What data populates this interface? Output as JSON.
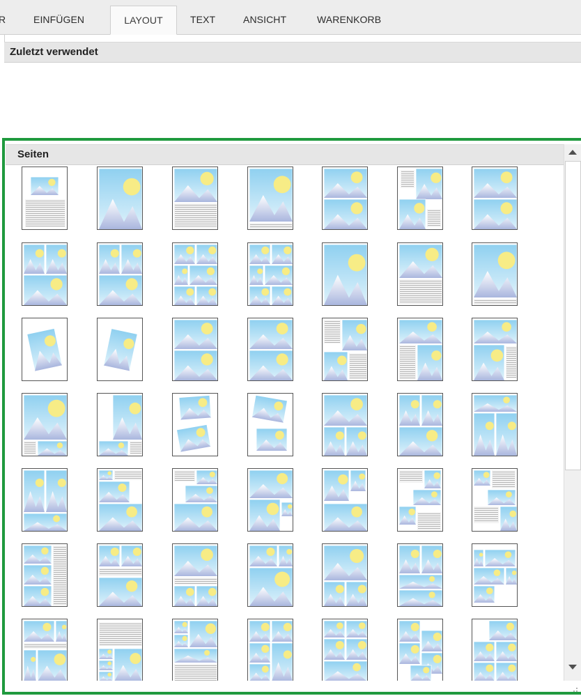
{
  "tabs": [
    {
      "label": "R",
      "active": false
    },
    {
      "label": "EINFÜGEN",
      "active": false
    },
    {
      "label": "LAYOUT",
      "active": true
    },
    {
      "label": "TEXT",
      "active": false
    },
    {
      "label": "ANSICHT",
      "active": false
    },
    {
      "label": "WARENKORB",
      "active": false
    }
  ],
  "recent": {
    "title": "Zuletzt verwendet"
  },
  "pages": {
    "title": "Seiten"
  },
  "colors": {
    "accent_border": "#1f9a3e",
    "photo_sky": "#bfe3f5",
    "photo_sun": "#f7ec86",
    "photo_mountain": "#e8eef8"
  },
  "icons": {
    "scroll_up": "triangle-up-icon",
    "scroll_down": "triangle-down-icon"
  },
  "layouts": [
    [
      "text-photo-small",
      "photo-full",
      "photo-text",
      "photo-textfoot",
      "photo-2h",
      "mixed-2",
      "photo-2h"
    ],
    [
      "photo-4",
      "photo-4",
      "photo-6",
      "photo-6",
      "photo-full",
      "photo-text",
      "photo-textfoot"
    ],
    [
      "tilted-1",
      "tilted-1b",
      "photo-2h",
      "photo-2h",
      "mixed-3",
      "mixed-3b",
      "mixed-3c"
    ],
    [
      "mixed-4",
      "mixed-4b",
      "tilted-2",
      "tilted-2b",
      "photo-3",
      "photo-3b",
      "photo-3c"
    ],
    [
      "photo-3d",
      "photo-4b",
      "mixed-5",
      "photo-4c",
      "mixed-5b",
      "mixed-6",
      "mixed-6b"
    ],
    [
      "mixed-7",
      "photo-text-2",
      "photo-text-3",
      "photo-3e",
      "photo-4d",
      "photo-4e",
      "photo-4f"
    ],
    [
      "photo-4g",
      "text-photo-2",
      "photo-6b",
      "photo-5",
      "photo-5b",
      "photo-5c",
      "photo-5d"
    ]
  ]
}
